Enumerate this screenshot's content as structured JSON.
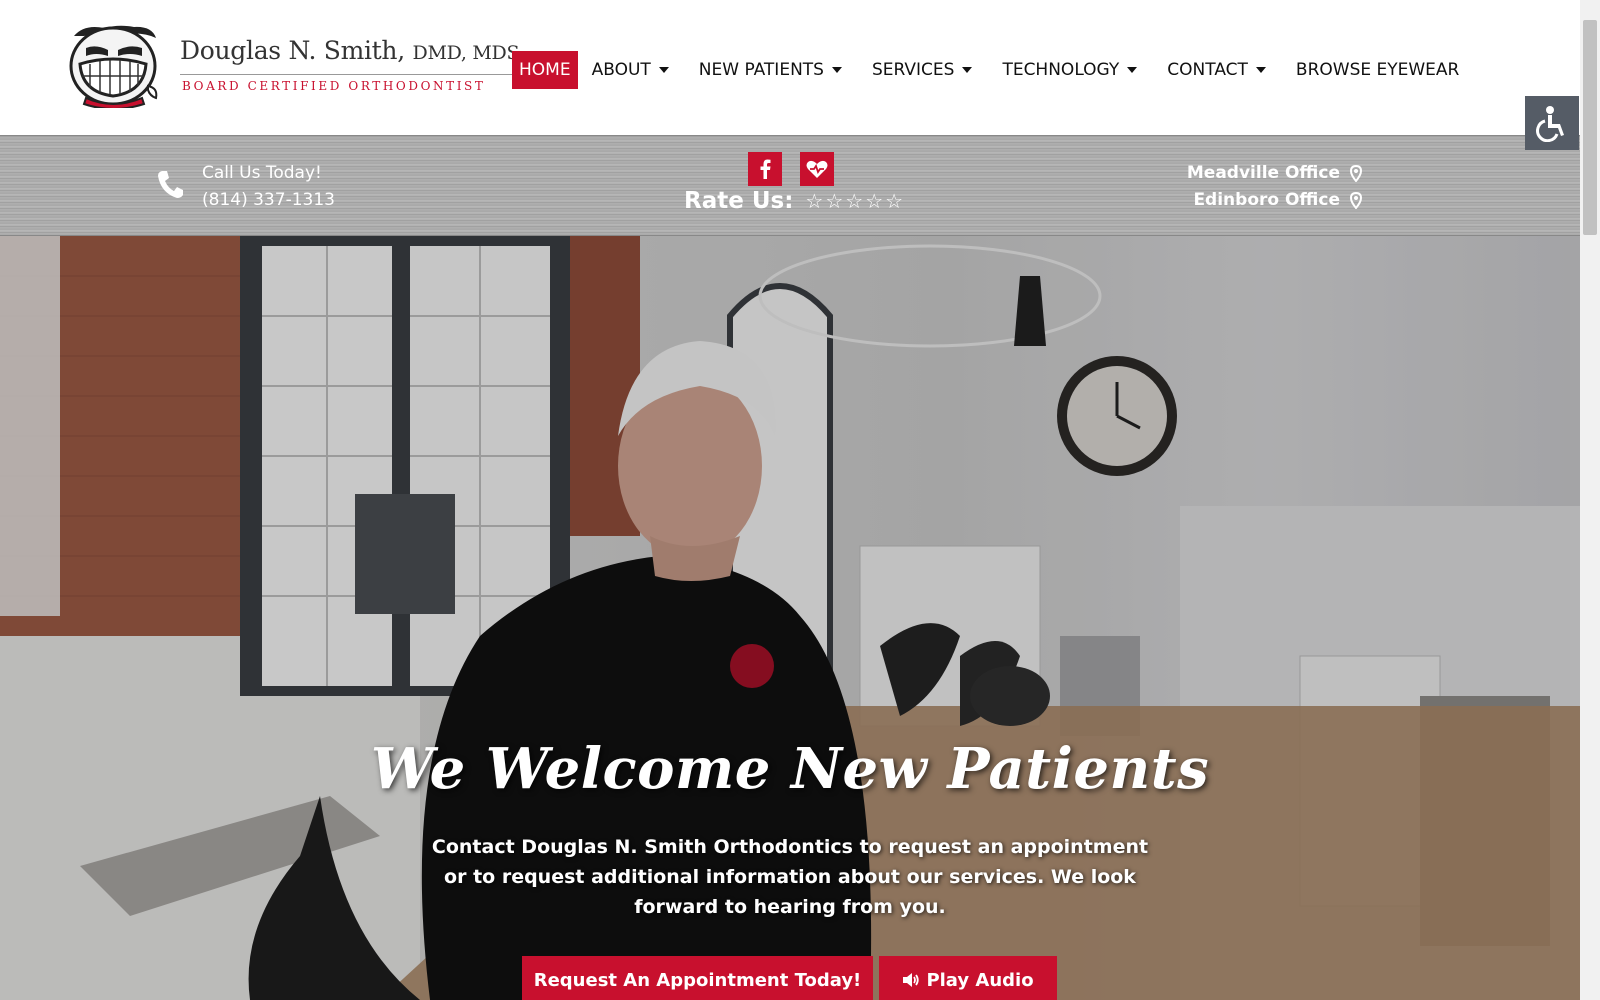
{
  "brand": {
    "name": "Douglas N. Smith,",
    "credentials": "DMD, MDS",
    "tagline": "BOARD CERTIFIED ORTHODONTIST"
  },
  "nav": {
    "items": [
      {
        "label": "HOME",
        "active": true,
        "dropdown": false
      },
      {
        "label": "ABOUT",
        "dropdown": true
      },
      {
        "label": "NEW PATIENTS",
        "dropdown": true
      },
      {
        "label": "SERVICES",
        "dropdown": true
      },
      {
        "label": "TECHNOLOGY",
        "dropdown": true
      },
      {
        "label": "CONTACT",
        "dropdown": true
      },
      {
        "label": "BROWSE EYEWEAR",
        "dropdown": false
      }
    ]
  },
  "infobar": {
    "call_label": "Call Us Today!",
    "phone": "(814) 337-1313",
    "rate_label": "Rate Us:",
    "stars": 5,
    "offices": [
      "Meadville Office",
      "Edinboro Office"
    ]
  },
  "hero": {
    "title": "We Welcome New Patients",
    "text": "Contact Douglas N. Smith Orthodontics to request an appointment or to request additional information about our services. We look forward to hearing from you.",
    "primary_button": "Request An Appointment Today!",
    "audio_button": "Play Audio"
  },
  "colors": {
    "accent": "#c8102e",
    "accessibility_button": "#555c66"
  },
  "icons": [
    "phone-icon",
    "facebook-icon",
    "healthgrades-icon",
    "star-icon",
    "map-pin-icon",
    "accessibility-icon",
    "speaker-icon"
  ]
}
